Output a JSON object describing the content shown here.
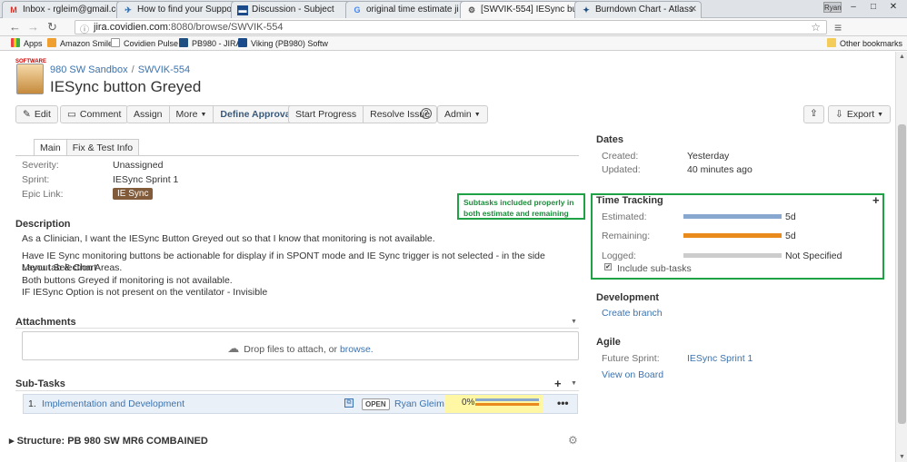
{
  "browser": {
    "tabs": [
      {
        "label": "Inbox - rgleim@gmail.co",
        "icon": "gmail-icon"
      },
      {
        "label": "How to find your Suppor",
        "icon": "help-icon"
      },
      {
        "label": "Discussion - Subject",
        "icon": "discussion-icon"
      },
      {
        "label": "original time estimate ji",
        "icon": "google-icon"
      },
      {
        "label": "[SWVIK-554] IESync butt",
        "icon": "jira-icon"
      },
      {
        "label": "Burndown Chart - Atlass",
        "icon": "jira-icon"
      }
    ],
    "user": "Ryan",
    "url_host": "jira.covidien.com",
    "url_rest": ":8080/browse/SWVIK-554",
    "bookmarks": [
      "Apps",
      "Amazon Smile",
      "Covidien Pulse",
      "PB980 - JIRA",
      "Viking (PB980) Softw"
    ],
    "other_bookmarks": "Other bookmarks"
  },
  "issue": {
    "logo_text": "SOFTWARE",
    "project": "980 SW Sandbox",
    "key": "SWVIK-554",
    "title": "IESync button Greyed"
  },
  "toolbar": {
    "edit": "Edit",
    "comment": "Comment",
    "assign": "Assign",
    "more": "More",
    "define_approvals": "Define Approvals",
    "start_progress": "Start Progress",
    "resolve_issue": "Resolve Issue",
    "admin": "Admin",
    "export": "Export"
  },
  "tabs": [
    "Main",
    "Fix & Test Info"
  ],
  "fields": {
    "severity_label": "Severity:",
    "severity_value": "Unassigned",
    "sprint_label": "Sprint:",
    "sprint_value": "IESync Sprint 1",
    "epic_label": "Epic Link:",
    "epic_value": "IE Sync"
  },
  "description": {
    "heading": "Description",
    "lines": [
      "As a Clinician, I want the IESync Button Greyed out so that I know that monitoring is not available.",
      "Have IE Sync monitoring buttons be actionable for display if in SPONT mode and IE Sync trigger is not selected - in the side Menu tab & Chart",
      "Layout Selection Areas.",
      "Both buttons Greyed if monitoring is not available.",
      "IF IESync Option is not present on the ventilator - Invisible"
    ]
  },
  "attachments": {
    "heading": "Attachments",
    "drop_text": "Drop files to attach, or",
    "browse": "browse."
  },
  "subtasks": {
    "heading": "Sub-Tasks",
    "rows": [
      {
        "num": "1.",
        "name": "Implementation and Development",
        "status": "OPEN",
        "assignee": "Ryan Gleim",
        "progress": "0%",
        "progress_fraction": 0
      }
    ]
  },
  "structure": "Structure: PB 980 SW MR6 COMBAINED",
  "dates": {
    "heading": "Dates",
    "created_label": "Created:",
    "created_value": "Yesterday",
    "updated_label": "Updated:",
    "updated_value": "40 minutes ago"
  },
  "time_tracking": {
    "heading": "Time Tracking",
    "estimated_label": "Estimated:",
    "estimated_value": "5d",
    "remaining_label": "Remaining:",
    "remaining_value": "5d",
    "logged_label": "Logged:",
    "logged_value": "Not Specified",
    "include_subtasks": "Include sub-tasks",
    "colors": {
      "estimated": "#89a8cf",
      "remaining": "#e88b1c",
      "logged": "#cccccc"
    }
  },
  "annotation": "Subtasks included properly in both estimate and remaining",
  "development": {
    "heading": "Development",
    "create_branch": "Create branch"
  },
  "agile": {
    "heading": "Agile",
    "future_sprint_label": "Future Sprint:",
    "future_sprint_value": "IESync Sprint 1",
    "view_on_board": "View on Board"
  }
}
